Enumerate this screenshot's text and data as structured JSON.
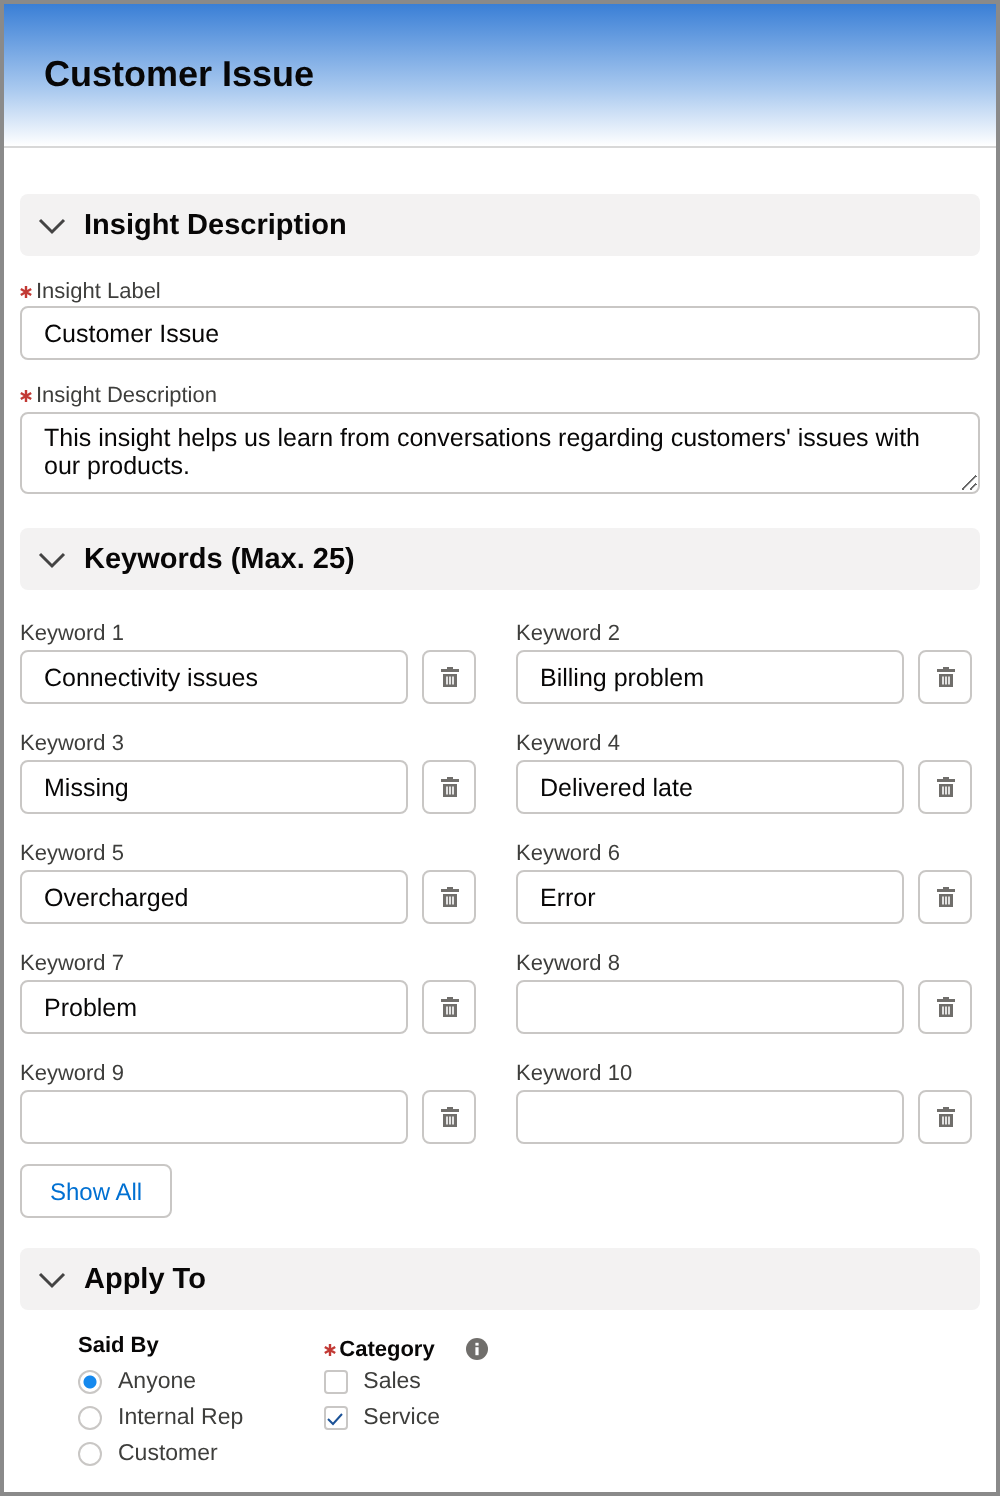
{
  "window": {
    "title": "Customer Issue"
  },
  "insight_section": {
    "title": "Insight Description",
    "label_field": {
      "label": "Insight Label",
      "required": true,
      "value": "Customer Issue"
    },
    "description_field": {
      "label": "Insight Description",
      "required": true,
      "value": "This insight helps us learn from conversations regarding customers' issues with our products."
    }
  },
  "keywords_section": {
    "title": "Keywords (Max. 25)",
    "keywords": [
      {
        "label": "Keyword 1",
        "value": "Connectivity issues"
      },
      {
        "label": "Keyword 2",
        "value": "Billing problem"
      },
      {
        "label": "Keyword 3",
        "value": "Missing"
      },
      {
        "label": "Keyword 4",
        "value": "Delivered late"
      },
      {
        "label": "Keyword 5",
        "value": "Overcharged"
      },
      {
        "label": "Keyword 6",
        "value": "Error"
      },
      {
        "label": "Keyword 7",
        "value": "Problem"
      },
      {
        "label": "Keyword 8"
      },
      {
        "label": "Keyword 9"
      },
      {
        "label": "Keyword 10"
      }
    ],
    "show_all_button": "Show All"
  },
  "apply_section": {
    "title": "Apply To",
    "said_by": {
      "label": "Said By",
      "options": [
        {
          "label": "Anyone",
          "selected": true
        },
        {
          "label": "Internal Rep",
          "selected": false
        },
        {
          "label": "Customer",
          "selected": false
        }
      ]
    },
    "category": {
      "label": "Category",
      "required": true,
      "options": [
        {
          "label": "Sales",
          "checked": false
        },
        {
          "label": "Service",
          "checked": true
        }
      ]
    }
  }
}
